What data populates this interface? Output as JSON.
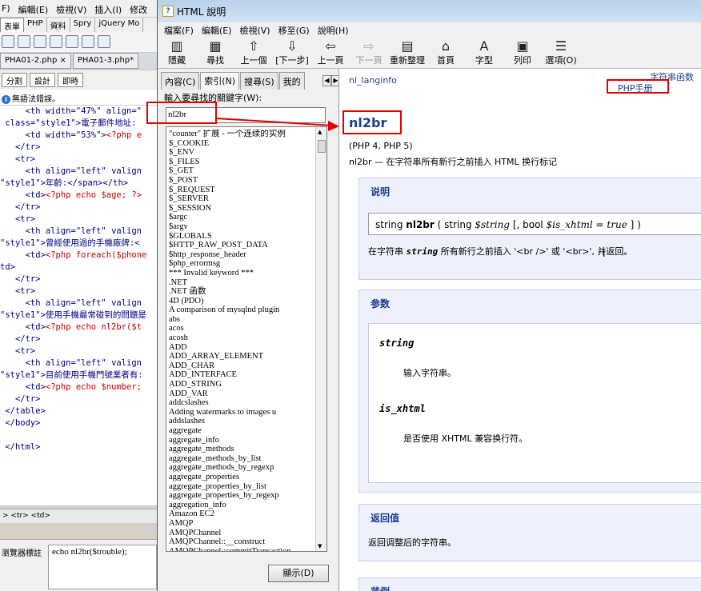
{
  "editor": {
    "menu": [
      "F)",
      "編輯(E)",
      "檢視(V)",
      "插入(I)",
      "修改"
    ],
    "category_tabs": [
      "表單",
      "PHP",
      "資料",
      "Spry",
      "jQuery Mo"
    ],
    "doc_tabs": [
      "PHA01-2.php ×",
      "PHA01-3.php*"
    ],
    "view_buttons": [
      "分割",
      "設計",
      "即時"
    ],
    "error_text": "無語法錯誤。",
    "code_lines": [
      {
        "a": "     <th width=\"47%\" align=\"",
        "b": ""
      },
      {
        "a": " class=\"style1\">",
        "b": "電子郵件地址:"
      },
      {
        "a": "     <td width=\"53%\">",
        "v": "<?php e"
      },
      {
        "a": "   </tr>"
      },
      {
        "a": "   <tr>"
      },
      {
        "a": "     <th align=\"left\" valign"
      },
      {
        "a": "\"style1\">",
        "b": "年齡:</span></th>"
      },
      {
        "a": "     <td>",
        "v": "<?php echo $age; ?>"
      },
      {
        "a": "   </tr>"
      },
      {
        "a": "   <tr>"
      },
      {
        "a": "     <th align=\"left\" valign"
      },
      {
        "a": "\"style1\">",
        "b": "曾經使用過的手機廠牌:<"
      },
      {
        "a": "     <td>",
        "v": "<?php foreach($phone"
      },
      {
        "a": "td>"
      },
      {
        "a": "   </tr>"
      },
      {
        "a": "   <tr>"
      },
      {
        "a": "     <th align=\"left\" valign"
      },
      {
        "a": "\"style1\">",
        "b": "使用手機最常碰到的問題是"
      },
      {
        "a": "     <td>",
        "v": "<?php echo nl2br($t"
      },
      {
        "a": "   </tr>"
      },
      {
        "a": "   <tr>"
      },
      {
        "a": "     <th align=\"left\" valign"
      },
      {
        "a": "\"style1\">",
        "b": "目前使用手機門號業者有:"
      },
      {
        "a": "     <td>",
        "v": "<?php echo $number;"
      },
      {
        "a": "   </tr>"
      },
      {
        "a": " </table>"
      },
      {
        "a": " </body>"
      },
      {
        "a": ""
      },
      {
        "a": " </html>"
      }
    ],
    "status_text": "> <tr> <td>",
    "prop_label": "瀏覽器標註",
    "prop_value": "echo nl2br($trouble);"
  },
  "help": {
    "title": "HTML 說明",
    "menu": [
      "檔案(F)",
      "編輯(E)",
      "檢視(V)",
      "移至(G)",
      "說明(H)"
    ],
    "toolbar": [
      {
        "g": "▥",
        "label": "隱藏",
        "enabled": true
      },
      {
        "g": "▦",
        "label": "尋找",
        "enabled": true
      },
      {
        "g": "⇧",
        "label": "上一個",
        "enabled": true
      },
      {
        "g": "⇩",
        "label": "[下一步]",
        "enabled": true
      },
      {
        "g": "⇦",
        "label": "上一頁",
        "enabled": true
      },
      {
        "g": "⇨",
        "label": "下一頁",
        "enabled": false
      },
      {
        "g": "▤",
        "label": "重新整理",
        "enabled": true
      },
      {
        "g": "⌂",
        "label": "首頁",
        "enabled": true
      },
      {
        "g": "A",
        "label": "字型",
        "enabled": true
      },
      {
        "g": "▣",
        "label": "列印",
        "enabled": true
      },
      {
        "g": "☰",
        "label": "選項(O)",
        "enabled": true
      }
    ],
    "nav_tabs": [
      "內容(C)",
      "索引(N)",
      "搜尋(S)",
      "我的"
    ],
    "keyword_label": "輸入要尋找的關鍵字(W):",
    "keyword_value": "nl2br",
    "index_items": [
      "\"counter\" 扩展 - 一个连续的实例",
      "$_COOKIE",
      "$_ENV",
      "$_FILES",
      "$_GET",
      "$_POST",
      "$_REQUEST",
      "$_SERVER",
      "$_SESSION",
      "$argc",
      "$argv",
      "$GLOBALS",
      "$HTTP_RAW_POST_DATA",
      "$http_response_header",
      "$php_errormsg",
      "*** Invalid keyword ***",
      ".NET",
      ".NET 函数",
      "4D (PDO)",
      "A comparison of mysqlnd plugin",
      "abs",
      "acos",
      "acosh",
      "ADD",
      "ADD_ARRAY_ELEMENT",
      "ADD_CHAR",
      "ADD_INTERFACE",
      "ADD_STRING",
      "ADD_VAR",
      "addcslashes",
      "Adding watermarks to images u",
      "addslashes",
      "aggregate",
      "aggregate_info",
      "aggregate_methods",
      "aggregate_methods_by_list",
      "aggregate_methods_by_regexp",
      "aggregate_properties",
      "aggregate_properties_by_list",
      "aggregate_properties_by_regexp",
      "aggregation_info",
      "Amazon EC2",
      "AMQP",
      "AMQPChannel",
      "AMQPChannel::__construct",
      "AMQPChannel::commitTransaction"
    ],
    "show_button": "顯示(D)"
  },
  "doc": {
    "breadcrumb": "nl_langinfo",
    "top_link": "字符串函数",
    "manual_link": "PHP手册",
    "func_name": "nl2br",
    "compat": "(PHP 4, PHP 5)",
    "desc": "nl2br — 在字符串所有新行之前插入 HTML 换行标记",
    "sec_desc": "说明",
    "sig": {
      "ret": "string",
      "name": "nl2br",
      "p1": "( string ",
      "v1": "$string",
      "p2": " [, bool ",
      "v2": "$is_xhtml = true",
      "p3": " ] )"
    },
    "sig_desc_pre": "在字符串 ",
    "sig_desc_code": "string",
    "sig_desc_post": " 所有新行之前插入 '<br />' 或 '<br>', 并返回。",
    "sec_params": "参数",
    "param1": "string",
    "param1_desc": "输入字符串。",
    "param2": "is_xhtml",
    "param2_desc": "是否使用 XHTML 兼容换行符。",
    "sec_return": "返回值",
    "return_desc": "返回调整后的字符串。",
    "sec_example": "范例"
  }
}
